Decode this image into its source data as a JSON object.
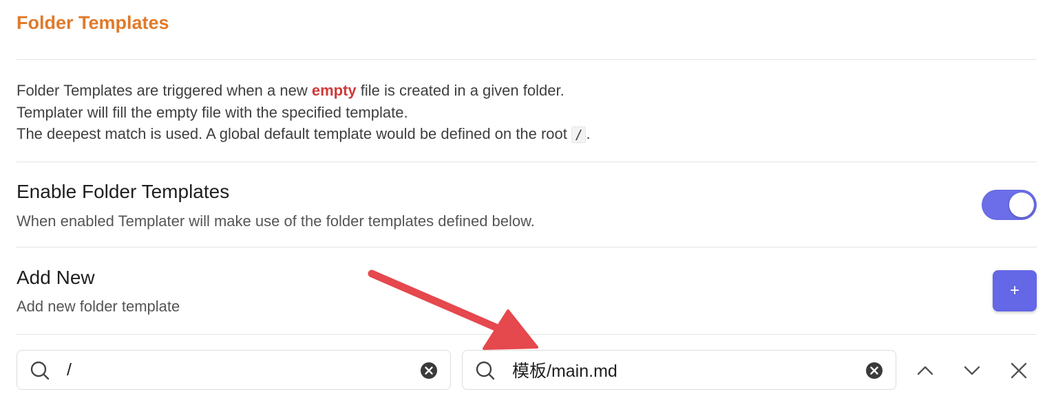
{
  "section": {
    "title": "Folder Templates"
  },
  "description": {
    "line1_prefix": "Folder Templates are triggered when a new ",
    "line1_emphasis": "empty",
    "line1_suffix": " file is created in a given folder.",
    "line2": "Templater will fill the empty file with the specified template.",
    "line3_prefix": "The deepest match is used. A global default template would be defined on the root ",
    "line3_code": "/",
    "line3_suffix": "."
  },
  "settings": {
    "enable": {
      "name": "Enable Folder Templates",
      "description": "When enabled Templater will make use of the folder templates defined below.",
      "enabled": true
    },
    "add_new": {
      "name": "Add New",
      "description": "Add new folder template",
      "button_label": "+"
    }
  },
  "folder_template": {
    "folder_value": "/",
    "template_value": "模板/main.md"
  },
  "icons": {
    "search": "search-icon",
    "clear": "clear-circle-icon",
    "move_up": "chevron-up-icon",
    "move_down": "chevron-down-icon",
    "delete": "close-icon"
  },
  "colors": {
    "title": "#e07a2a",
    "emphasis": "#d03a3a",
    "accent": "#6467e6",
    "annotation_arrow": "#e5484d"
  }
}
